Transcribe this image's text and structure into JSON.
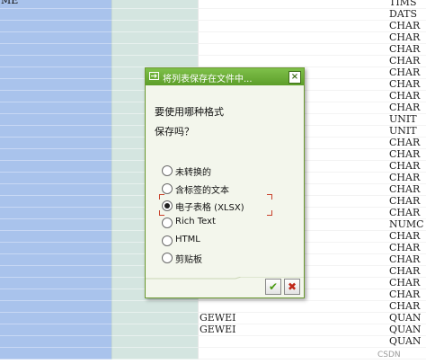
{
  "background_table": {
    "first_label": "ME",
    "types": [
      "TIMS",
      "DATS",
      "CHAR",
      "CHAR",
      "CHAR",
      "CHAR",
      "CHAR",
      "CHAR",
      "CHAR",
      "CHAR",
      "UNIT",
      "UNIT",
      "CHAR",
      "CHAR",
      "CHAR",
      "CHAR",
      "CHAR",
      "CHAR",
      "CHAR",
      "NUMC",
      "CHAR",
      "CHAR",
      "CHAR",
      "CHAR",
      "CHAR",
      "CHAR",
      "CHAR",
      "QUAN",
      "QUAN",
      "QUAN"
    ],
    "values": {
      "27": "GEWEI",
      "28": "GEWEI"
    }
  },
  "dialog": {
    "title": "将列表保存在文件中...",
    "question_line1": "要使用哪种格式",
    "question_line2": "保存吗？",
    "options": [
      {
        "label": "未转换的",
        "selected": false
      },
      {
        "label": "含标签的文本",
        "selected": false
      },
      {
        "label": "电子表格 (XLSX)",
        "selected": true
      },
      {
        "label": "Rich Text",
        "selected": false
      },
      {
        "label": "HTML",
        "selected": false
      },
      {
        "label": "剪贴板",
        "selected": false
      }
    ],
    "close_icon": "close-icon",
    "ok_icon": "checkmark-icon",
    "cancel_icon": "cross-icon",
    "colors": {
      "titlebar": "#5c9e2a",
      "ok": "#4a9a12",
      "cancel": "#c0281a"
    }
  },
  "watermark": "CSDN"
}
